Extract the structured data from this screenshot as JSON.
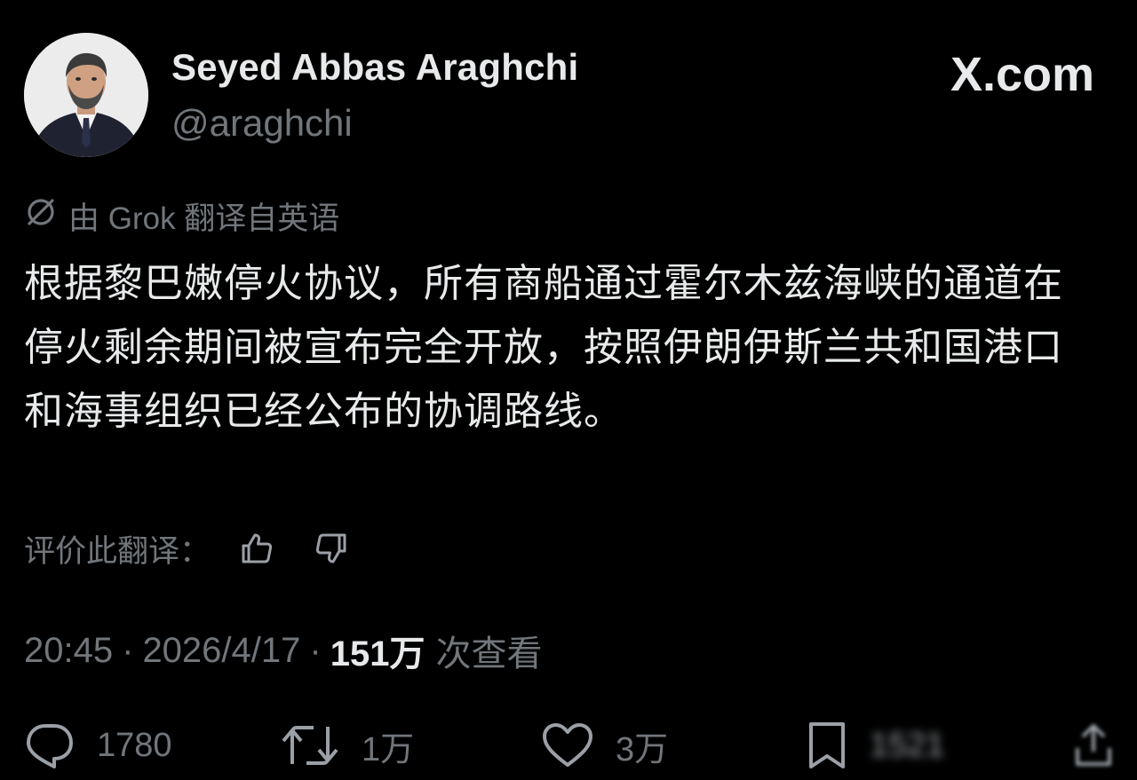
{
  "author": {
    "name": "Seyed Abbas Araghchi",
    "handle": "@araghchi"
  },
  "brand": "X.com",
  "translation_note": "由 Grok 翻译自英语",
  "post_text": "根据黎巴嫩停火协议，所有商船通过霍尔木兹海峡的通道在停火剩余期间被宣布完全开放，按照伊朗伊斯兰共和国港口和海事组织已经公布的协调路线。",
  "rate_label": "评价此翻译：",
  "meta": {
    "time": "20:45",
    "date": "2026/4/17",
    "views_count": "151万",
    "views_label": "次查看",
    "separator": "·"
  },
  "actions": {
    "replies": "1780",
    "reposts": "1万",
    "likes": "3万",
    "bookmarks": "1521"
  },
  "icons": {
    "avatar": "profile-photo",
    "brand_logo": "x-logo",
    "translate": "translate-icon",
    "thumbs_up": "thumbs-up-icon",
    "thumbs_down": "thumbs-down-icon",
    "reply": "reply-icon",
    "repost": "repost-icon",
    "like": "heart-icon",
    "bookmark": "bookmark-icon",
    "share": "share-icon"
  },
  "colors": {
    "background": "#000000",
    "text": "#e7e9ea",
    "secondary": "#71767b"
  }
}
